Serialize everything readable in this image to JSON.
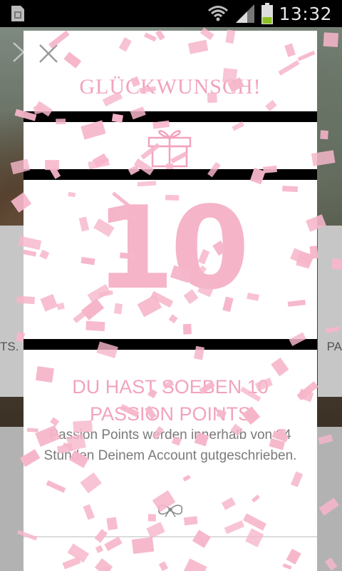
{
  "status_bar": {
    "time": "13:32",
    "icons": [
      "sim-card-icon",
      "wifi-icon",
      "signal-icon",
      "battery-icon"
    ]
  },
  "background": {
    "left_text": "TS.",
    "right_text": "PA"
  },
  "modal": {
    "title": "GLÜCKWUNSCH!",
    "points_number": "10",
    "headline": "DU HAST SOEBEN 10 PASSION POINTS",
    "description": "Passion Points werden innerhalb von 24 Stunden Deinem Account gutgeschrieben.",
    "icons": [
      "close-icon",
      "gift-icon",
      "bow-icon"
    ]
  },
  "colors": {
    "accent_pink": "#f2a3bd",
    "confetti_pink": "#f6b6ca",
    "band_black": "#000000",
    "description_gray": "#7a7a7a"
  }
}
